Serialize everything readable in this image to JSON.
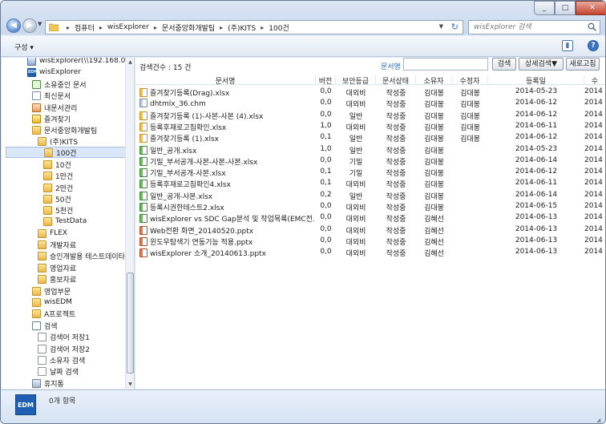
{
  "breadcrumbs": [
    "컴퓨터",
    "wisExplorer",
    "문서중앙화개발팀",
    "(주)KITS",
    "100건"
  ],
  "search": {
    "placeholder": "wisExplorer 검색"
  },
  "toolbar": {
    "organize_label": "구성 ▾"
  },
  "sidebar": {
    "items": [
      {
        "label": "wisExplorer(\\\\192.168.0.160",
        "icon": "network-drive-icon"
      },
      {
        "label": "wisExplorer",
        "icon": "edm-icon"
      },
      {
        "label": "소유중인 문서",
        "icon": "check-doc-icon"
      },
      {
        "label": "최신문서",
        "icon": "doc-icon"
      },
      {
        "label": "내문서관리",
        "icon": "people-icon"
      },
      {
        "label": "즐겨찾기",
        "icon": "star-folder-icon"
      },
      {
        "label": "문서중앙화개발팀",
        "icon": "folder-icon"
      },
      {
        "label": "(주)KITS",
        "icon": "folder-icon"
      },
      {
        "label": "100건",
        "icon": "folder-icon"
      },
      {
        "label": "10건",
        "icon": "folder-icon"
      },
      {
        "label": "1만건",
        "icon": "folder-icon"
      },
      {
        "label": "2만건",
        "icon": "folder-icon"
      },
      {
        "label": "50건",
        "icon": "folder-icon"
      },
      {
        "label": "5천건",
        "icon": "folder-icon"
      },
      {
        "label": "TestData",
        "icon": "folder-icon"
      },
      {
        "label": "FLEX",
        "icon": "folder-icon"
      },
      {
        "label": "개발자료",
        "icon": "folder-icon"
      },
      {
        "label": "승인개발용 테스트데이타",
        "icon": "folder-icon"
      },
      {
        "label": "영업자료",
        "icon": "folder-icon"
      },
      {
        "label": "홍보자료",
        "icon": "folder-icon"
      },
      {
        "label": "영업부문",
        "icon": "folder-icon"
      },
      {
        "label": "wisEDM",
        "icon": "folder-icon"
      },
      {
        "label": "A프로젝트",
        "icon": "folder-icon"
      },
      {
        "label": "검색",
        "icon": "search-icon"
      },
      {
        "label": "검색어 저장1",
        "icon": "saved-search-icon"
      },
      {
        "label": "검색어 저장2",
        "icon": "saved-search-icon"
      },
      {
        "label": "소유자 검색",
        "icon": "saved-search-icon"
      },
      {
        "label": "날짜 검색",
        "icon": "saved-search-icon"
      },
      {
        "label": "휴지통",
        "icon": "trash-icon"
      }
    ]
  },
  "main": {
    "count_label": "검색건수 : 15 건",
    "field_label": "문서명",
    "search_button": "검색",
    "advanced_button": "상세검색▼",
    "reset_button": "새로고침",
    "columns": [
      "문서명",
      "버전",
      "보안등급",
      "문서상태",
      "소유자",
      "수정자",
      "등록일",
      "수"
    ],
    "rows": [
      {
        "type": "xlsx",
        "name": "즐겨찾기등록(Drag).xlsx",
        "version": "0,0",
        "security": "대외비",
        "status": "작성중",
        "owner": "김대봉",
        "editor": "김대봉",
        "date": "2014-05-23",
        "extra": "2014"
      },
      {
        "type": "chm",
        "name": "dhtmlx_36.chm",
        "version": "0,0",
        "security": "대외비",
        "status": "작성중",
        "owner": "김대봉",
        "editor": "김대봉",
        "date": "2014-06-12",
        "extra": "2014"
      },
      {
        "type": "xlsx",
        "name": "즐겨찾기등록 (1)-사본-사본 (4).xlsx",
        "version": "0,0",
        "security": "일반",
        "status": "작성중",
        "owner": "김대봉",
        "editor": "김대봉",
        "date": "2014-06-12",
        "extra": "2014"
      },
      {
        "type": "xlsx",
        "name": "등록후재로고침확인.xlsx",
        "version": "1,0",
        "security": "대외비",
        "status": "작성중",
        "owner": "김대봉",
        "editor": "김대봉",
        "date": "2014-06-11",
        "extra": "2014"
      },
      {
        "type": "xlsx",
        "name": "즐겨찾기등록 (1).xlsx",
        "version": "0,1",
        "security": "일반",
        "status": "작성중",
        "owner": "김대봉",
        "editor": "김대봉",
        "date": "2014-06-12",
        "extra": "2014"
      },
      {
        "type": "gx",
        "name": "일반_공개.xlsx",
        "version": "1,0",
        "security": "일반",
        "status": "작성중",
        "owner": "김대봉",
        "editor": "",
        "date": "2014-05-23",
        "extra": "2014"
      },
      {
        "type": "gx",
        "name": "기밀_부서공개-사본-사본-사본.xlsx",
        "version": "0,0",
        "security": "기밀",
        "status": "작성중",
        "owner": "김대봉",
        "editor": "",
        "date": "2014-06-14",
        "extra": "2014"
      },
      {
        "type": "gx",
        "name": "기밀_부서공개-사본.xlsx",
        "version": "0,1",
        "security": "기밀",
        "status": "작성중",
        "owner": "김대봉",
        "editor": "",
        "date": "2014-06-12",
        "extra": "2014"
      },
      {
        "type": "gx",
        "name": "등록후재로고침확인4.xlsx",
        "version": "0,1",
        "security": "대외비",
        "status": "작성중",
        "owner": "김대봉",
        "editor": "",
        "date": "2014-06-11",
        "extra": "2014"
      },
      {
        "type": "gx",
        "name": "일반_공개-사본.xlsx",
        "version": "0,2",
        "security": "일반",
        "status": "작성중",
        "owner": "김대봉",
        "editor": "",
        "date": "2014-06-14",
        "extra": "2014"
      },
      {
        "type": "gx",
        "name": "등록시권한테스트2.xlsx",
        "version": "0,0",
        "security": "대외비",
        "status": "작성중",
        "owner": "김대봉",
        "editor": "",
        "date": "2014-06-15",
        "extra": "2014"
      },
      {
        "type": "gx",
        "name": "wisExplorer vs SDC Gap분석 및 작업목록(EMC전...",
        "version": "0,0",
        "security": "대외비",
        "status": "작성중",
        "owner": "김혜선",
        "editor": "",
        "date": "2014-06-13",
        "extra": "2014"
      },
      {
        "type": "pptx",
        "name": "Web전환 화면_20140520.pptx",
        "version": "0,0",
        "security": "대외비",
        "status": "작성중",
        "owner": "김혜선",
        "editor": "",
        "date": "2014-06-13",
        "extra": "2014"
      },
      {
        "type": "pptx",
        "name": "윈도우탐색기 연동기능 적용.pptx",
        "version": "0,0",
        "security": "대외비",
        "status": "작성중",
        "owner": "김혜선",
        "editor": "",
        "date": "2014-06-13",
        "extra": "2014"
      },
      {
        "type": "pptx",
        "name": "wisExplorer 소개_20140613.pptx",
        "version": "0,0",
        "security": "대외비",
        "status": "작성중",
        "owner": "김혜선",
        "editor": "",
        "date": "2014-06-13",
        "extra": "2014"
      }
    ]
  },
  "statusbar": {
    "logo_text": "EDM",
    "text": "0개 항목"
  },
  "colors": {
    "accent": "#2a6fc9",
    "close_button": "#c7432c",
    "logo": "#1f5fb3"
  }
}
